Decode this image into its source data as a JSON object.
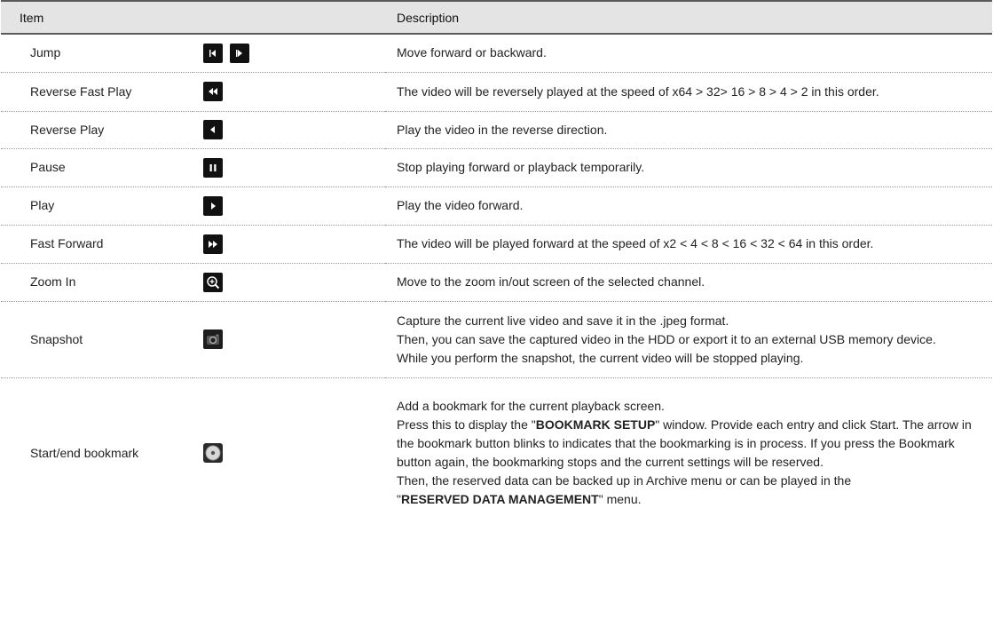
{
  "header": {
    "item": "Item",
    "description": "Description"
  },
  "rows": [
    {
      "item": "Jump",
      "icons": [
        "jump-backward-icon",
        "jump-forward-icon"
      ],
      "description": "Move forward or backward."
    },
    {
      "item": "Reverse Fast Play",
      "icons": [
        "reverse-fast-play-icon"
      ],
      "description": "The video will be reversely played at the speed of x64 > 32> 16 > 8 > 4 > 2 in this order."
    },
    {
      "item": "Reverse Play",
      "icons": [
        "reverse-play-icon"
      ],
      "description": "Play the video in the reverse direction."
    },
    {
      "item": "Pause",
      "icons": [
        "pause-icon"
      ],
      "description": "Stop playing forward or playback temporarily."
    },
    {
      "item": "Play",
      "icons": [
        "play-icon"
      ],
      "description": "Play the video forward."
    },
    {
      "item": "Fast Forward",
      "icons": [
        "fast-forward-icon"
      ],
      "description": "The video will be played forward at the speed of x2 < 4 < 8 < 16 < 32 < 64 in this order."
    },
    {
      "item": "Zoom In",
      "icons": [
        "zoom-in-icon"
      ],
      "description": "Move to the zoom in/out screen of the selected channel."
    },
    {
      "item": "Snapshot",
      "icons": [
        "camera-icon"
      ],
      "description_lines": [
        "Capture the current live video and save it in the .jpeg format.",
        "Then, you can save the captured video in the HDD or export it to an external USB memory device.",
        "While you perform the snapshot, the current video will be stopped playing."
      ]
    },
    {
      "item": "Start/end bookmark",
      "icons": [
        "bookmark-disc-icon"
      ],
      "description_parts": {
        "l1": "Add a bookmark for the current playback screen.",
        "l2_pre": "Press this to display the \"",
        "l2_strong": "BOOKMARK SETUP",
        "l2_post": "\" window. Provide each entry and click Start. The arrow in the bookmark button blinks to indicates that the bookmarking is in process. If you press the Bookmark button again, the bookmarking stops and the current settings will be reserved.",
        "l3": "Then, the reserved data can be backed up in Archive menu or can be played in the",
        "l4_pre": "\"",
        "l4_strong": "RESERVED DATA MANAGEMENT",
        "l4_post": "\" menu."
      }
    }
  ]
}
